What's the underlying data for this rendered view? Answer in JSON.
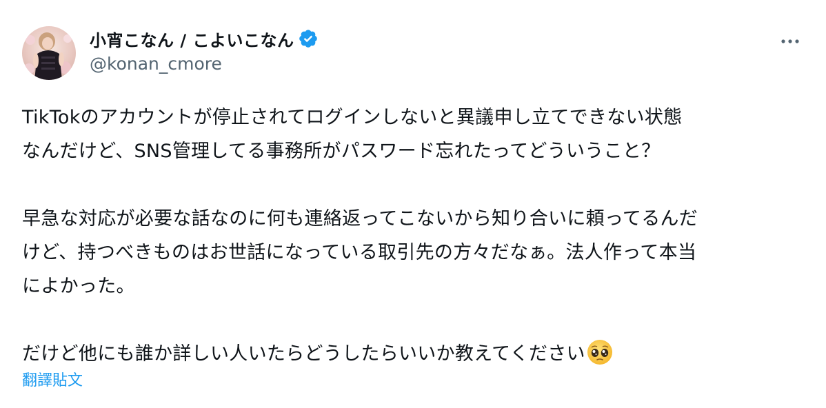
{
  "author": {
    "display_name": "小宵こなん / こよいこなん",
    "handle": "@konan_cmore",
    "verified": true
  },
  "tweet": {
    "line1": "TikTokのアカウントが停止されてログインしないと異議申し立てできない状態",
    "line2": "なんだけど、SNS管理してる事務所がパスワード忘れたってどういうこと？",
    "line3": "早急な対応が必要な話なのに何も連絡返ってこないから知り合いに頼ってるんだ",
    "line4": "けど、持つべきものはお世話になっている取引先の方々だなぁ。法人作って本当",
    "line5": "によかった。",
    "line6": "だけど他にも誰か詳しい人いたらどうしたらいいか教えてください"
  },
  "actions": {
    "translate_label": "翻譯貼文"
  },
  "icons": {
    "verified": "verified-badge-icon",
    "more": "more-options-icon",
    "emoji": "pleading-face-emoji"
  },
  "colors": {
    "accent": "#1d9bf0",
    "text": "#0f1419",
    "secondary": "#536471"
  }
}
